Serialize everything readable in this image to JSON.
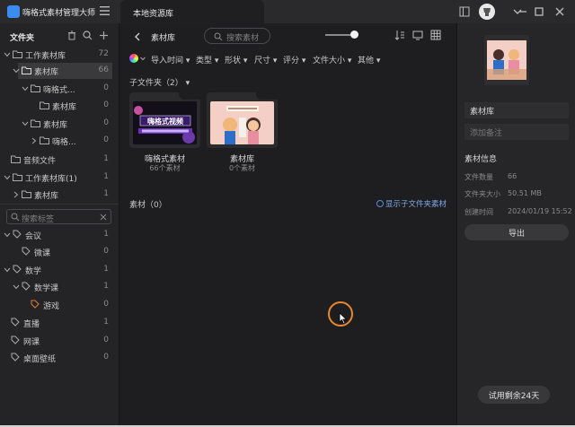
{
  "app": {
    "title": "嗨格式素材管理大师"
  },
  "tab": {
    "label": "本地资源库"
  },
  "sidebar": {
    "header": "文件夹",
    "folders": [
      {
        "label": "工作素材库",
        "count": "72"
      },
      {
        "label": "素材库",
        "count": "66"
      },
      {
        "label": "嗨格式...",
        "count": "0"
      },
      {
        "label": "素材库",
        "count": "0"
      },
      {
        "label": "素材库",
        "count": "0"
      },
      {
        "label": "嗨格...",
        "count": "0"
      },
      {
        "label": "音频文件",
        "count": "1"
      },
      {
        "label": "工作素材库(1)",
        "count": "1"
      },
      {
        "label": "素材库",
        "count": "1"
      }
    ],
    "tag_search_placeholder": "搜索标签",
    "tags": [
      {
        "label": "会议",
        "count": "1"
      },
      {
        "label": "微课",
        "count": "0"
      },
      {
        "label": "数学",
        "count": "1"
      },
      {
        "label": "数学课",
        "count": "1"
      },
      {
        "label": "游戏",
        "count": "0"
      },
      {
        "label": "直播",
        "count": "1"
      },
      {
        "label": "网课",
        "count": "0"
      },
      {
        "label": "桌面壁纸",
        "count": "0"
      }
    ]
  },
  "main": {
    "breadcrumb": "素材库",
    "search_placeholder": "搜索素材",
    "filters": [
      "导入时间",
      "类型",
      "形状",
      "尺寸",
      "评分",
      "文件大小",
      "其他"
    ],
    "subfolder_title": "子文件夹（2）",
    "subfolders": [
      {
        "name": "嗨格式素材",
        "count": "66个素材",
        "thumb_caption": "嗨格式视频"
      },
      {
        "name": "素材库",
        "count": "0个素材",
        "thumb_caption": ""
      }
    ],
    "assets_title": "素材（0）",
    "show_subfolder_assets": "显示子文件夹素材"
  },
  "panel": {
    "name": "素材库",
    "note_placeholder": "添加备注",
    "info_title": "素材信息",
    "info": [
      {
        "key": "文件数量",
        "value": "66"
      },
      {
        "key": "文件夹大小",
        "value": "50.51 MB"
      },
      {
        "key": "创建时间",
        "value": "2024/01/19 15:52"
      }
    ],
    "export_label": "导出",
    "trial_label": "试用剩余24天"
  }
}
